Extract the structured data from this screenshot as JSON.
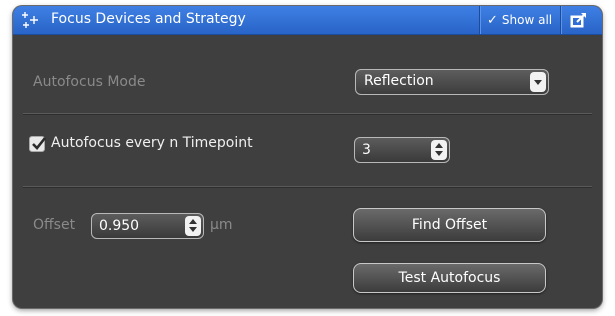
{
  "header": {
    "title": "Focus Devices and Strategy",
    "show_all": "Show all",
    "accent": "#2f6fd6"
  },
  "autofocus_mode": {
    "label": "Autofocus Mode",
    "selected": "Reflection"
  },
  "timepoint": {
    "label": "Autofocus every n Timepoint",
    "checked": true,
    "value": "3"
  },
  "offset": {
    "label": "Offset",
    "value": "0.950",
    "unit": "µm"
  },
  "buttons": {
    "find_offset": "Find Offset",
    "test_autofocus": "Test Autofocus"
  }
}
